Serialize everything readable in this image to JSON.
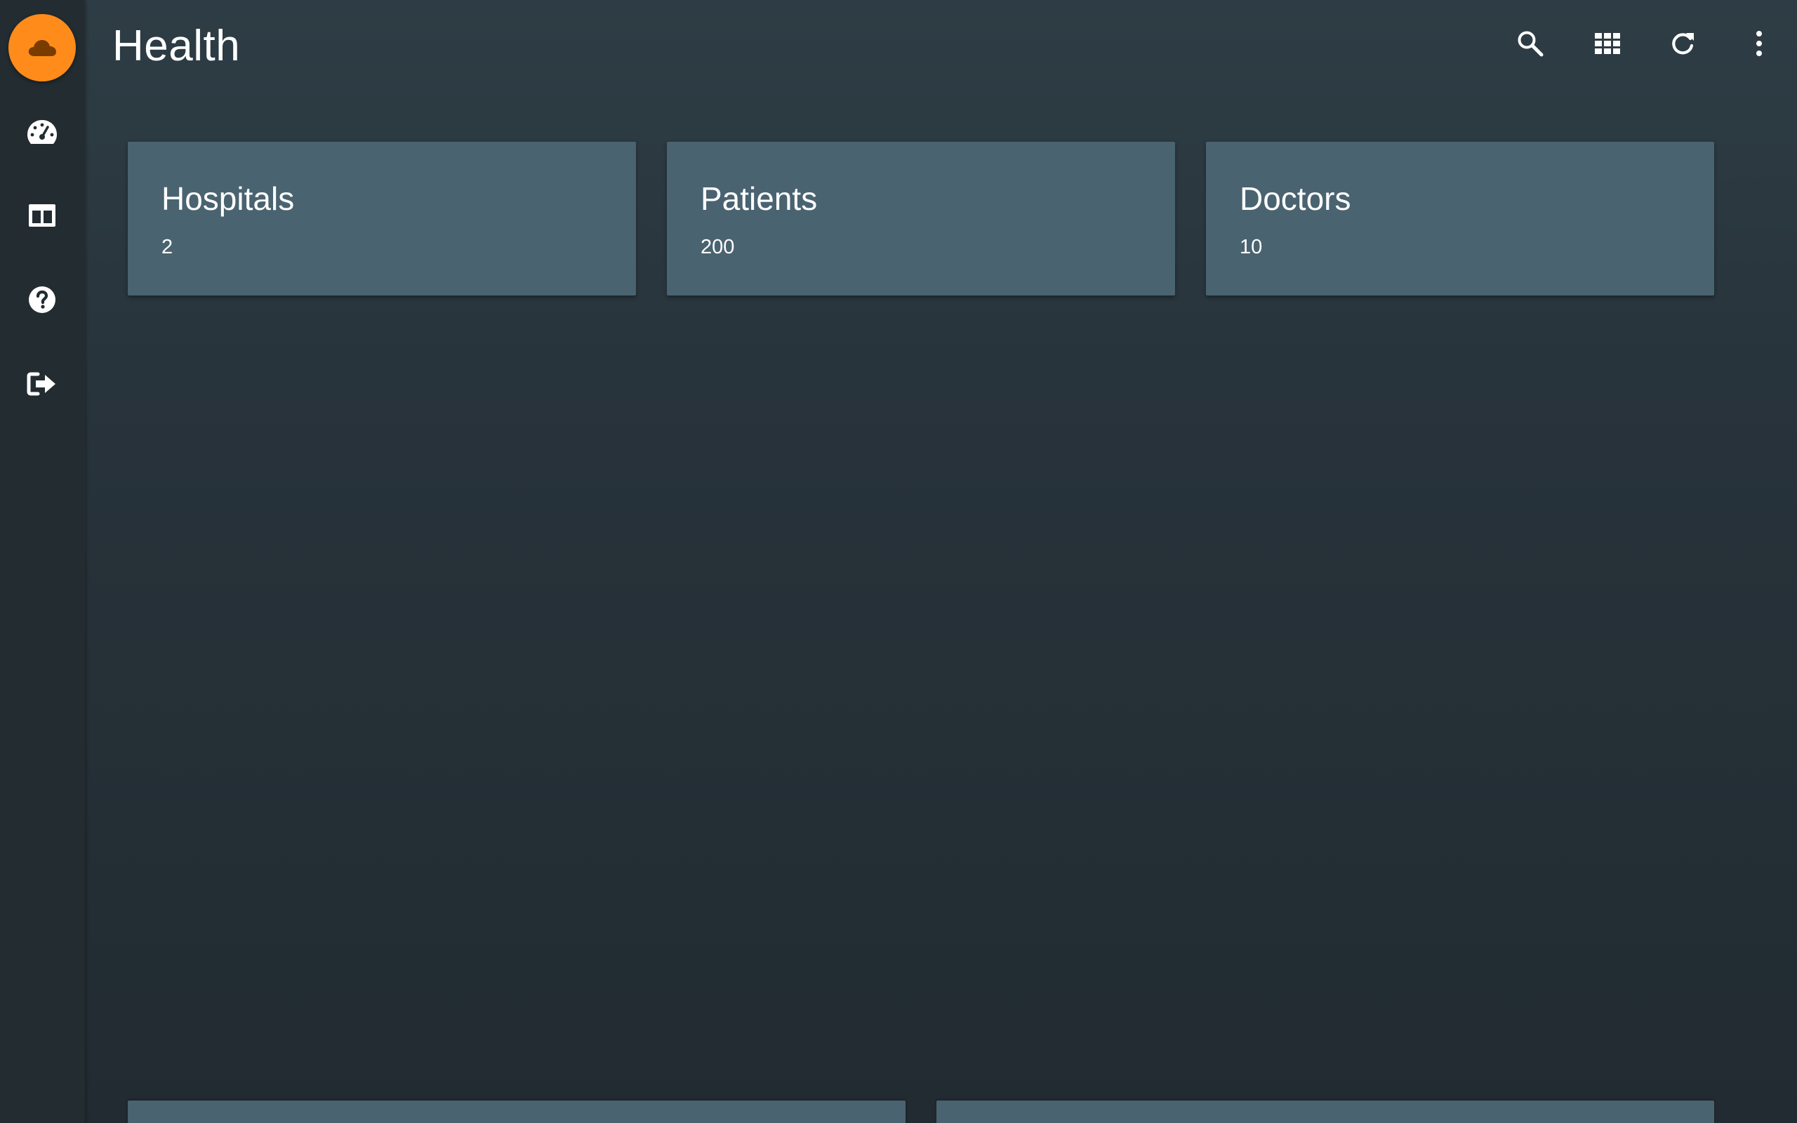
{
  "app": {
    "title": "Health",
    "accent_color": "#ff8c1a",
    "logo_icon": "cloud-icon"
  },
  "sidebar": {
    "items": [
      {
        "icon": "dashboard-gauge-icon",
        "label": "Dashboard"
      },
      {
        "icon": "layout-columns-icon",
        "label": "Layout"
      },
      {
        "icon": "help-icon",
        "label": "Help"
      },
      {
        "icon": "logout-icon",
        "label": "Logout"
      }
    ]
  },
  "toolbar": {
    "icons": [
      "search-icon",
      "grid-apps-icon",
      "refresh-icon",
      "more-vert-icon"
    ]
  },
  "cards": [
    {
      "title": "Hospitals",
      "value": "2"
    },
    {
      "title": "Patients",
      "value": "200"
    },
    {
      "title": "Doctors",
      "value": "10"
    }
  ]
}
